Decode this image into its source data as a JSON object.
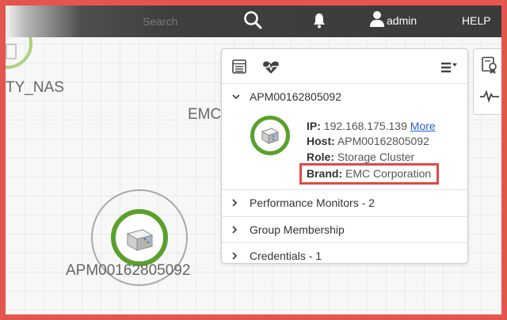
{
  "topbar": {
    "search_placeholder": "Search",
    "user_name": "admin",
    "help_label": "HELP"
  },
  "canvas": {
    "node_nas_label": "TY_NAS",
    "node_emc_label": "EMC",
    "node_apm_label": "APM00162805092"
  },
  "popup": {
    "device_title": "APM00162805092",
    "ip_key": "IP:",
    "ip_value": "192.168.175.139",
    "more_link": "More",
    "host_key": "Host:",
    "host_value": "APM00162805092",
    "role_key": "Role:",
    "role_value": "Storage Cluster",
    "brand_key": "Brand:",
    "brand_value": "EMC Corporation",
    "sections": [
      {
        "label": "Performance Monitors - 2"
      },
      {
        "label": "Group Membership"
      },
      {
        "label": "Credentials - 1"
      }
    ]
  },
  "colors": {
    "frame_border": "#e45550",
    "status_ring": "#5aa02c",
    "highlight": "#e04848",
    "link": "#2a5bd7"
  },
  "icons": [
    "search-icon",
    "bell-icon",
    "user-icon",
    "list-icon",
    "heart-pulse-icon",
    "menu-icon",
    "certificate-icon",
    "pulse-icon",
    "storage-icon",
    "chevron-down-icon",
    "chevron-right-icon"
  ]
}
